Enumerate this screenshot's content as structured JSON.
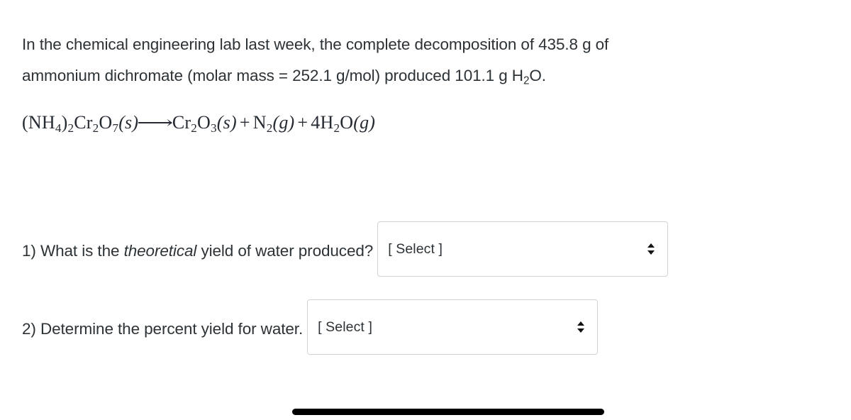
{
  "problem": {
    "line1_a": "In the chemical engineering lab last week, the complete decomposition of 435.8 g of",
    "line2_a": "ammonium dichromate (molar mass = 252.1 g/mol) produced 101.1 g H",
    "line2_sub": "2",
    "line2_b": "O."
  },
  "equation": {
    "reactant_open": "(NH",
    "reactant_nh_sub": "4",
    "reactant_close": ")",
    "reactant_paren_sub": "2",
    "reactant_cr": "Cr",
    "reactant_cr_sub": "2",
    "reactant_o": "O",
    "reactant_o_sub": "7",
    "reactant_state": "(s)",
    "arrow": "⟶",
    "p1_cr": "Cr",
    "p1_cr_sub": "2",
    "p1_o": "O",
    "p1_o_sub": "3",
    "p1_state": "(s)",
    "plus": "+",
    "p2_n": "N",
    "p2_n_sub": "2",
    "p2_state": "(g)",
    "p3_coeff": "4H",
    "p3_h_sub": "2",
    "p3_o": "O",
    "p3_state": "(g)"
  },
  "questions": [
    {
      "number": "1)",
      "text_before_em": "What is the ",
      "emphasis": "theoretical",
      "text_after_em": " yield of water produced?",
      "select_value": "[ Select ]",
      "chevron_icon": "chevron-up-down-icon"
    },
    {
      "number": "2)",
      "text_before_em": "Determine the percent yield for water.",
      "emphasis": "",
      "text_after_em": "",
      "select_value": "[ Select ]",
      "chevron_icon": "chevron-up-down-icon"
    }
  ],
  "colors": {
    "text": "#2c3236",
    "equation_text": "#262b33",
    "select_border": "#cfd2d6",
    "background": "#ffffff",
    "scrollbar_thumb": "#000000"
  },
  "scrollbar": {
    "orientation": "horizontal",
    "thumb_label": "horizontal-scroll-thumb"
  }
}
